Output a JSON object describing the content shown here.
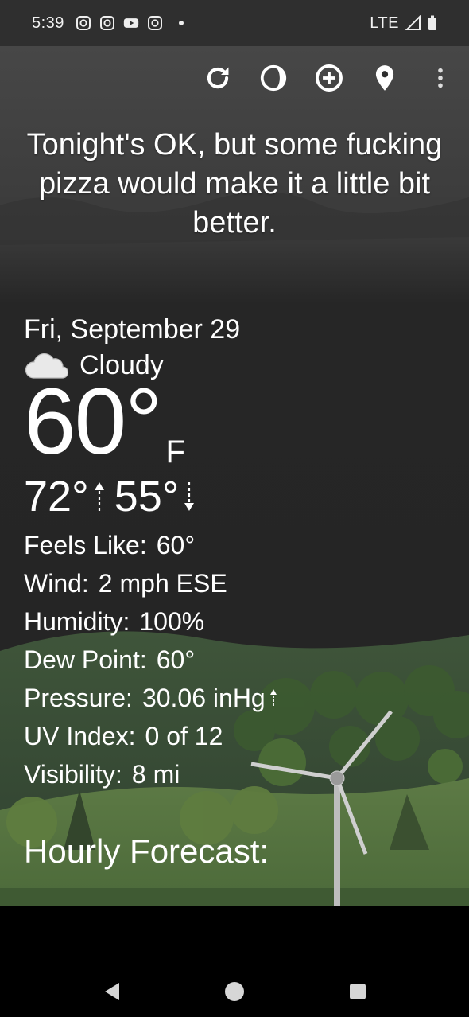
{
  "status_bar": {
    "time": "5:39",
    "app_icons": [
      "instagram-icon",
      "instagram-icon",
      "youtube-icon",
      "instagram-icon"
    ],
    "network": "LTE"
  },
  "toolbar": {
    "buttons": [
      "refresh-icon",
      "theme-icon",
      "add-location-icon",
      "location-pin-icon",
      "more-vert-icon"
    ]
  },
  "headline": "Tonight's OK, but some fucking pizza would make it a little bit better.",
  "weather": {
    "date": "Fri, September 29",
    "condition": "Cloudy",
    "temperature": "60°",
    "unit": "F",
    "high": "72°",
    "low": "55°"
  },
  "details": {
    "feels_like_label": "Feels Like:",
    "feels_like_value": "60°",
    "wind_label": "Wind:",
    "wind_value": "2 mph ESE",
    "humidity_label": "Humidity:",
    "humidity_value": "100%",
    "dew_point_label": "Dew Point:",
    "dew_point_value": "60°",
    "pressure_label": "Pressure:",
    "pressure_value": "30.06 inHg",
    "uv_label": "UV Index:",
    "uv_value": "0 of 12",
    "visibility_label": "Visibility:",
    "visibility_value": "8 mi"
  },
  "hourly_title": "Hourly Forecast:",
  "colors": {
    "background": "#2b2b2b",
    "hills": "#4a6b3c",
    "text": "#ffffff"
  }
}
